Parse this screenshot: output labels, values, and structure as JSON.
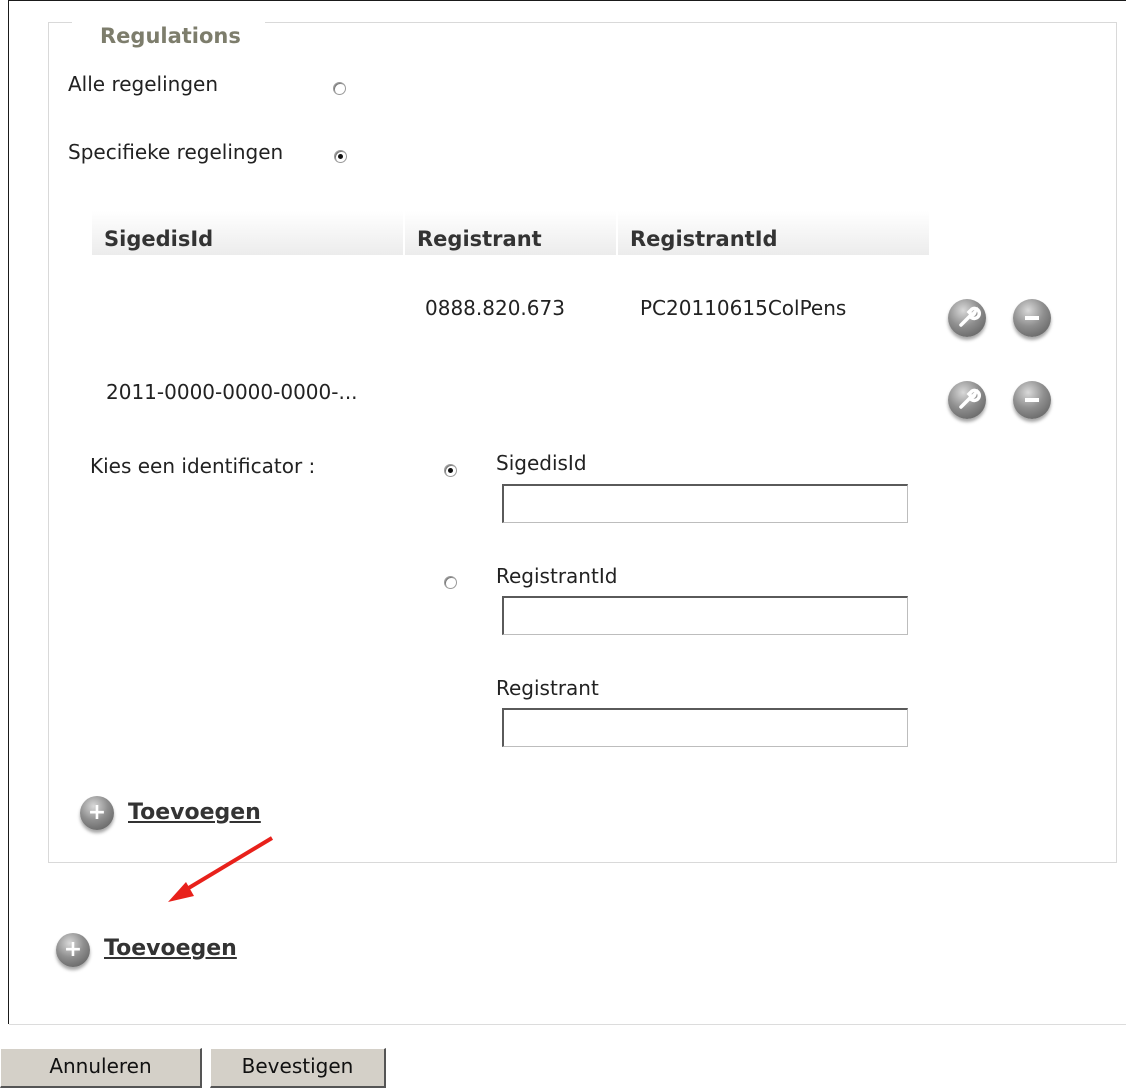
{
  "fieldset": {
    "legend": "Regulations"
  },
  "scope": {
    "all_label": "Alle regelingen",
    "all_checked": false,
    "specific_label": "Specifieke regelingen",
    "specific_checked": true
  },
  "table": {
    "headers": [
      "SigedisId",
      "Registrant",
      "RegistrantId"
    ],
    "rows": [
      {
        "sigedis_id": "",
        "registrant": "0888.820.673",
        "registrant_id": "PC20110615ColPens"
      },
      {
        "sigedis_id": "2011-0000-0000-0000-...",
        "registrant": "",
        "registrant_id": ""
      }
    ],
    "row_actions": {
      "edit_icon": "wrench-icon",
      "remove_icon": "minus-icon"
    }
  },
  "identifier": {
    "label": "Kies een identificator :",
    "option_sigedis": "SigedisId",
    "option_sigedis_checked": true,
    "sigedis_value": "",
    "option_registrant_id": "RegistrantId",
    "option_registrant_id_checked": false,
    "registrant_id_value": "",
    "registrant_label": "Registrant",
    "registrant_value": ""
  },
  "inner_add": {
    "label": " Toevoegen",
    "icon": "plus-icon"
  },
  "outer_add": {
    "label": " Toevoegen",
    "icon": "plus-icon"
  },
  "annotation": {
    "arrow_color": "#e8211b"
  },
  "footer": {
    "cancel_label": "Annuleren",
    "confirm_label": "Bevestigen"
  }
}
